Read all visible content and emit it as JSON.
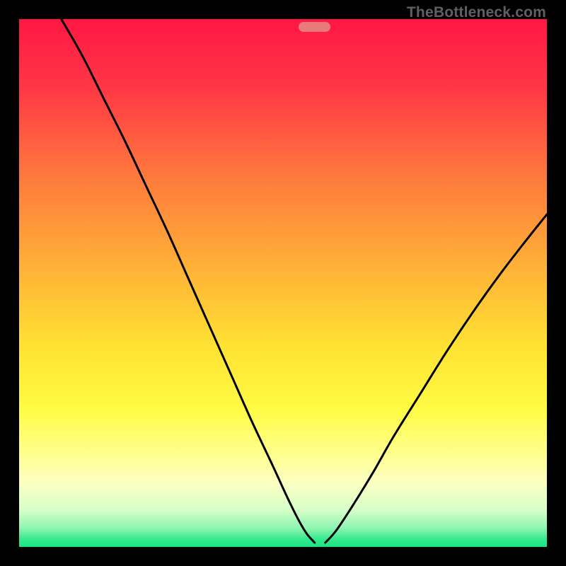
{
  "watermark": "TheBottleneck.com",
  "chart_data": {
    "type": "line",
    "title": "",
    "xlabel": "",
    "ylabel": "",
    "xlim": [
      0,
      100
    ],
    "ylim": [
      0,
      100
    ],
    "gradient": {
      "direction": "vertical",
      "stops": [
        {
          "pos": 0.0,
          "color": "#ff1744"
        },
        {
          "pos": 0.13,
          "color": "#ff3745"
        },
        {
          "pos": 0.3,
          "color": "#ff7a3c"
        },
        {
          "pos": 0.48,
          "color": "#ffb437"
        },
        {
          "pos": 0.62,
          "color": "#ffe233"
        },
        {
          "pos": 0.74,
          "color": "#fffb44"
        },
        {
          "pos": 0.82,
          "color": "#ffff8a"
        },
        {
          "pos": 0.88,
          "color": "#fbffc2"
        },
        {
          "pos": 0.93,
          "color": "#d6ffc8"
        },
        {
          "pos": 0.965,
          "color": "#8cf5b0"
        },
        {
          "pos": 0.985,
          "color": "#37e98d"
        },
        {
          "pos": 1.0,
          "color": "#16e784"
        }
      ]
    },
    "optimal_marker": {
      "x_center": 56,
      "width": 6,
      "y": 98.5,
      "color": "#e87a7a"
    },
    "series": [
      {
        "name": "left-branch",
        "x": [
          8,
          12,
          16,
          20,
          24,
          28,
          32,
          36,
          40,
          44,
          48,
          51,
          53,
          54.5,
          56
        ],
        "y": [
          100,
          93,
          85,
          77,
          68.5,
          60,
          51,
          42,
          33,
          24,
          15.5,
          9,
          5,
          2.5,
          0.8
        ]
      },
      {
        "name": "right-branch",
        "x": [
          58,
          60,
          63,
          67,
          71,
          76,
          81,
          86,
          91,
          96,
          100
        ],
        "y": [
          0.8,
          3,
          7.5,
          14,
          21,
          29,
          37,
          44.5,
          51.5,
          58,
          63
        ]
      }
    ],
    "annotations": []
  }
}
